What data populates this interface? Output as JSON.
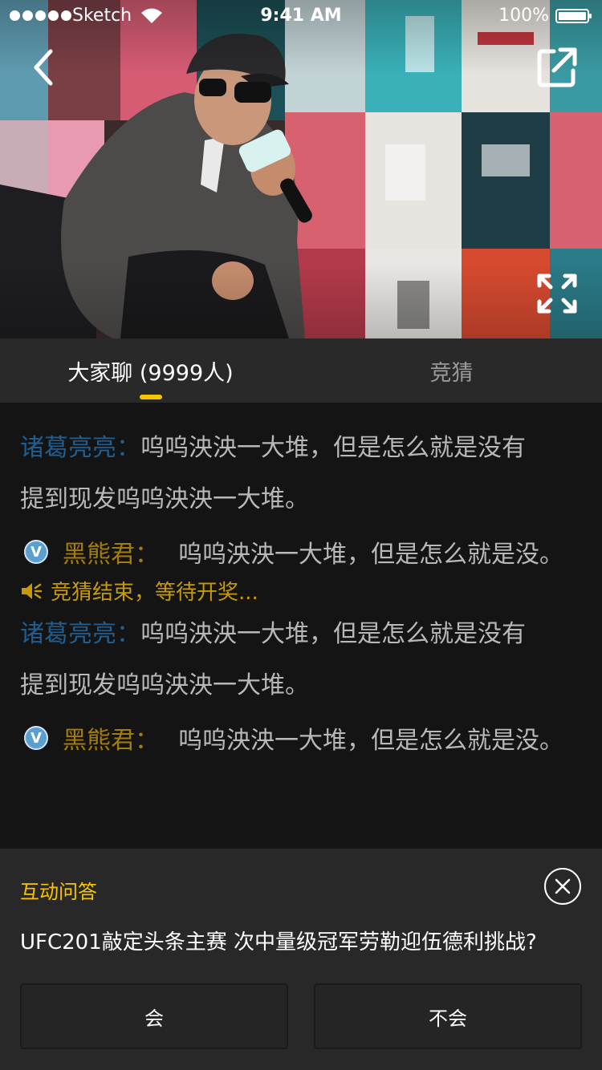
{
  "status_bar": {
    "carrier": "Sketch",
    "time": "9:41 AM",
    "battery": "100%"
  },
  "video": {
    "icons": {
      "back": "chevron-left-icon",
      "share": "share-external-icon",
      "fullscreen": "expand-fullscreen-icon"
    }
  },
  "tabs": {
    "chat_label": "大家聊 (9999人)",
    "guess_label": "竞猜",
    "active": "chat",
    "accent": "#f7c500"
  },
  "chat": {
    "messages": [
      {
        "name": "诸葛亮亮",
        "sep": "：",
        "text": "呜呜泱泱一大堆，但是怎么就是没有",
        "text2": "提到现发呜呜泱泱一大堆。"
      },
      {
        "name": "黑熊君",
        "sep": "：",
        "text": "呜呜泱泱一大堆，但是怎么就是没。",
        "badge": "V"
      },
      {
        "notice": "竞猜结束，等待开奖..."
      },
      {
        "name": "诸葛亮亮",
        "sep": "：",
        "text": "呜呜泱泱一大堆，但是怎么就是没有",
        "text2": "提到现发呜呜泱泱一大堆。"
      },
      {
        "name": "黑熊君",
        "sep": "：",
        "text": "呜呜泱泱一大堆，但是怎么就是没。",
        "badge": "V"
      }
    ],
    "colors": {
      "name_blue": "#1f5e91",
      "name_gold": "#a37d0b",
      "notice": "#c79a08"
    }
  },
  "qa": {
    "title": "互动问答",
    "question": "UFC201敲定头条主赛 次中量级冠军劳勒迎伍德利挑战?",
    "yes_label": "会",
    "no_label": "不会",
    "close_icon": "close-circle-icon"
  }
}
